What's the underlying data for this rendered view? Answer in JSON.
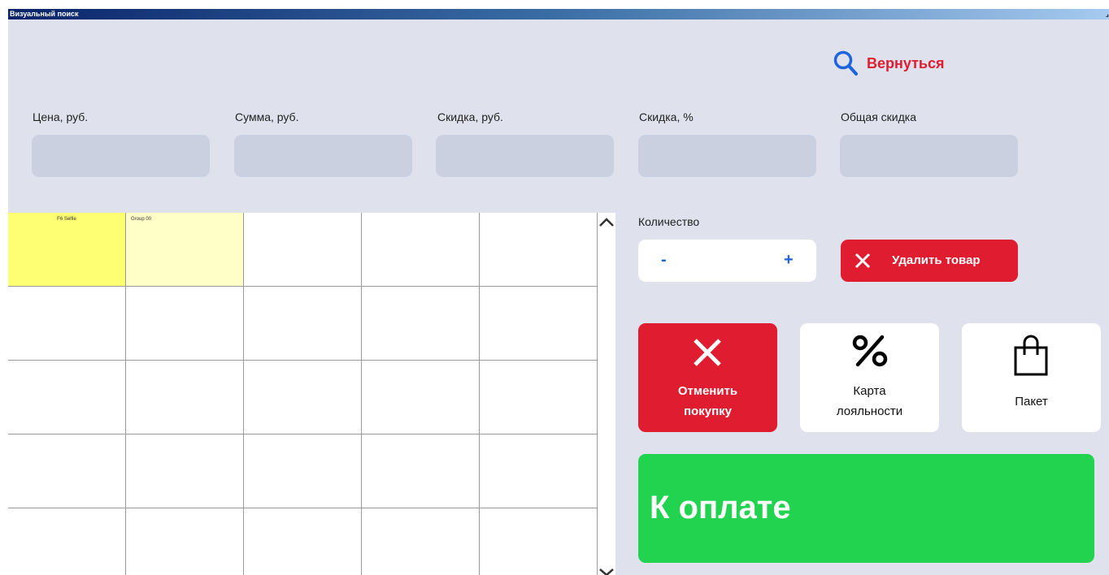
{
  "window": {
    "title": "Визуальный поиск"
  },
  "header": {
    "back_label": "Вернуться",
    "back_icon": "search-icon",
    "accent": "#e01d30"
  },
  "fields": [
    {
      "label": "Цена, руб.",
      "value": ""
    },
    {
      "label": "Сумма, руб.",
      "value": ""
    },
    {
      "label": "Скидка, руб.",
      "value": ""
    },
    {
      "label": "Скидка, %",
      "value": ""
    },
    {
      "label": "Общая скидка",
      "value": ""
    }
  ],
  "grid": {
    "cells": [
      {
        "label": "F6 Selfie",
        "color": "#ffff73"
      },
      {
        "label": "Group 00",
        "color": "#ffffc8"
      }
    ]
  },
  "quantity": {
    "label": "Количество",
    "minus": "-",
    "plus": "+"
  },
  "actions": {
    "delete_label": "Удалить товар",
    "cancel_label_1": "Отменить",
    "cancel_label_2": "покупку",
    "loyalty_label_1": "Карта",
    "loyalty_label_2": "лояльности",
    "bag_label": "Пакет",
    "pay_label": "К оплате"
  },
  "colors": {
    "red": "#e01d30",
    "green": "#21d34f",
    "panel": "#dfe1ec",
    "field": "#cbd0e1"
  }
}
